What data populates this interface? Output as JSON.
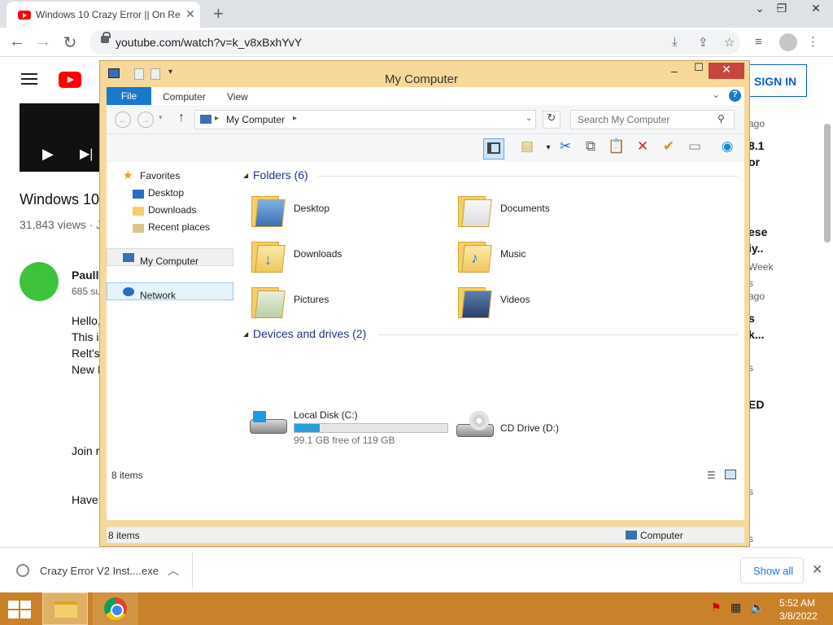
{
  "browser": {
    "tab_title": "Windows 10 Crazy Error || On Re",
    "url": "youtube.com/watch?v=k_v8xBxhYvY"
  },
  "youtube": {
    "signin": "SIGN IN",
    "video_title": "Windows 10",
    "views": "31,843 views · J",
    "channel": "Paully",
    "subs": "685 su",
    "desc_lines": [
      "Hello,",
      "This i",
      "Relt's",
      "New I",
      "Join r",
      "Have"
    ],
    "side_texts": [
      "ago",
      "8.1",
      "or",
      "ese",
      "iy..",
      "Week",
      "s",
      "ago",
      "s",
      "k...",
      "s",
      "ED",
      "s",
      "s"
    ]
  },
  "download": {
    "file": "Crazy Error V2 Inst....exe",
    "show_all": "Show all"
  },
  "taskbar": {
    "time": "5:52 AM",
    "date": "3/8/2022"
  },
  "explorer": {
    "title": "My Computer",
    "ribbon_tabs": [
      "File",
      "Computer",
      "View"
    ],
    "help": "?",
    "address": "My Computer",
    "search_placeholder": "Search My Computer",
    "nav": {
      "favorites": "Favorites",
      "fav_items": [
        "Desktop",
        "Downloads",
        "Recent places"
      ],
      "computer": "My Computer",
      "network": "Network"
    },
    "folders_header": "Folders (6)",
    "folders": [
      "Desktop",
      "Documents",
      "Downloads",
      "Music",
      "Pictures",
      "Videos"
    ],
    "devices_header": "Devices and drives (2)",
    "local_disk": {
      "name": "Local Disk (C:)",
      "free": "99.1 GB free of 119 GB",
      "used_fraction": 0.167
    },
    "cd_drive": "CD Drive (D:)",
    "item_count": "8 items",
    "status_left": "8 items",
    "status_right": "Computer"
  },
  "colors": {
    "window_frame": "#f6d99a",
    "close_button": "#c7463f",
    "file_tab": "#1979ca",
    "taskbar": "#c9822a",
    "disk_fill": "#26a0da"
  }
}
